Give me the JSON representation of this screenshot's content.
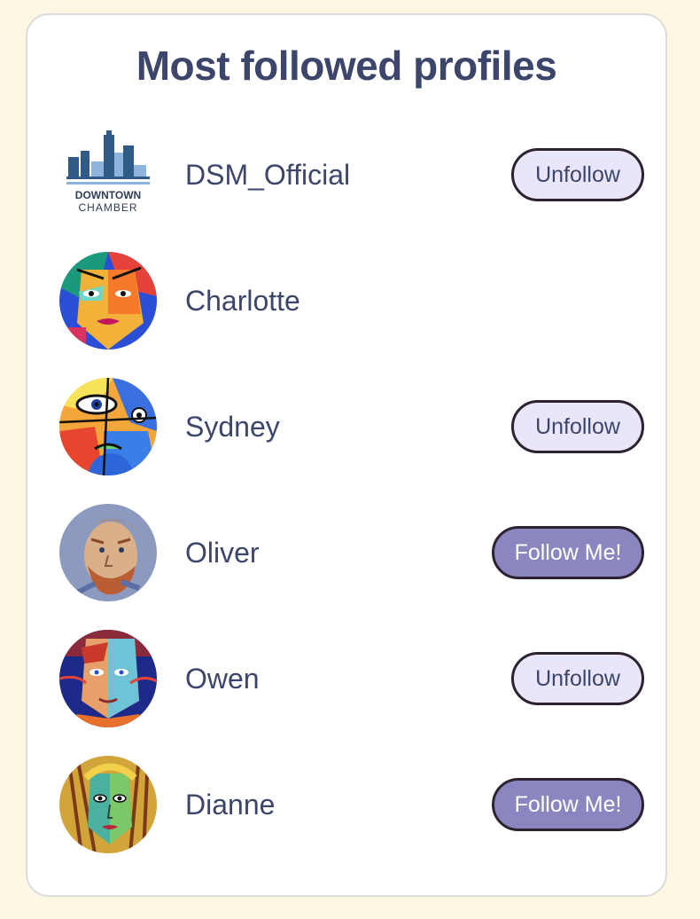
{
  "header": {
    "title": "Most followed profiles"
  },
  "profiles": [
    {
      "name": "DSM_Official",
      "action": "Unfollow",
      "logo_line1": "DOWNTOWN",
      "logo_line2": "CHAMBER"
    },
    {
      "name": "Charlotte",
      "action": ""
    },
    {
      "name": "Sydney",
      "action": "Unfollow"
    },
    {
      "name": "Oliver",
      "action": "Follow Me!"
    },
    {
      "name": "Owen",
      "action": "Unfollow"
    },
    {
      "name": "Dianne",
      "action": "Follow Me!"
    }
  ],
  "colors": {
    "page_background": "#fdf7e4",
    "title": "#3c466b",
    "unfollow_button": "#e9e6fb",
    "follow_button": "#8b86c0",
    "button_border": "#2c2230"
  }
}
